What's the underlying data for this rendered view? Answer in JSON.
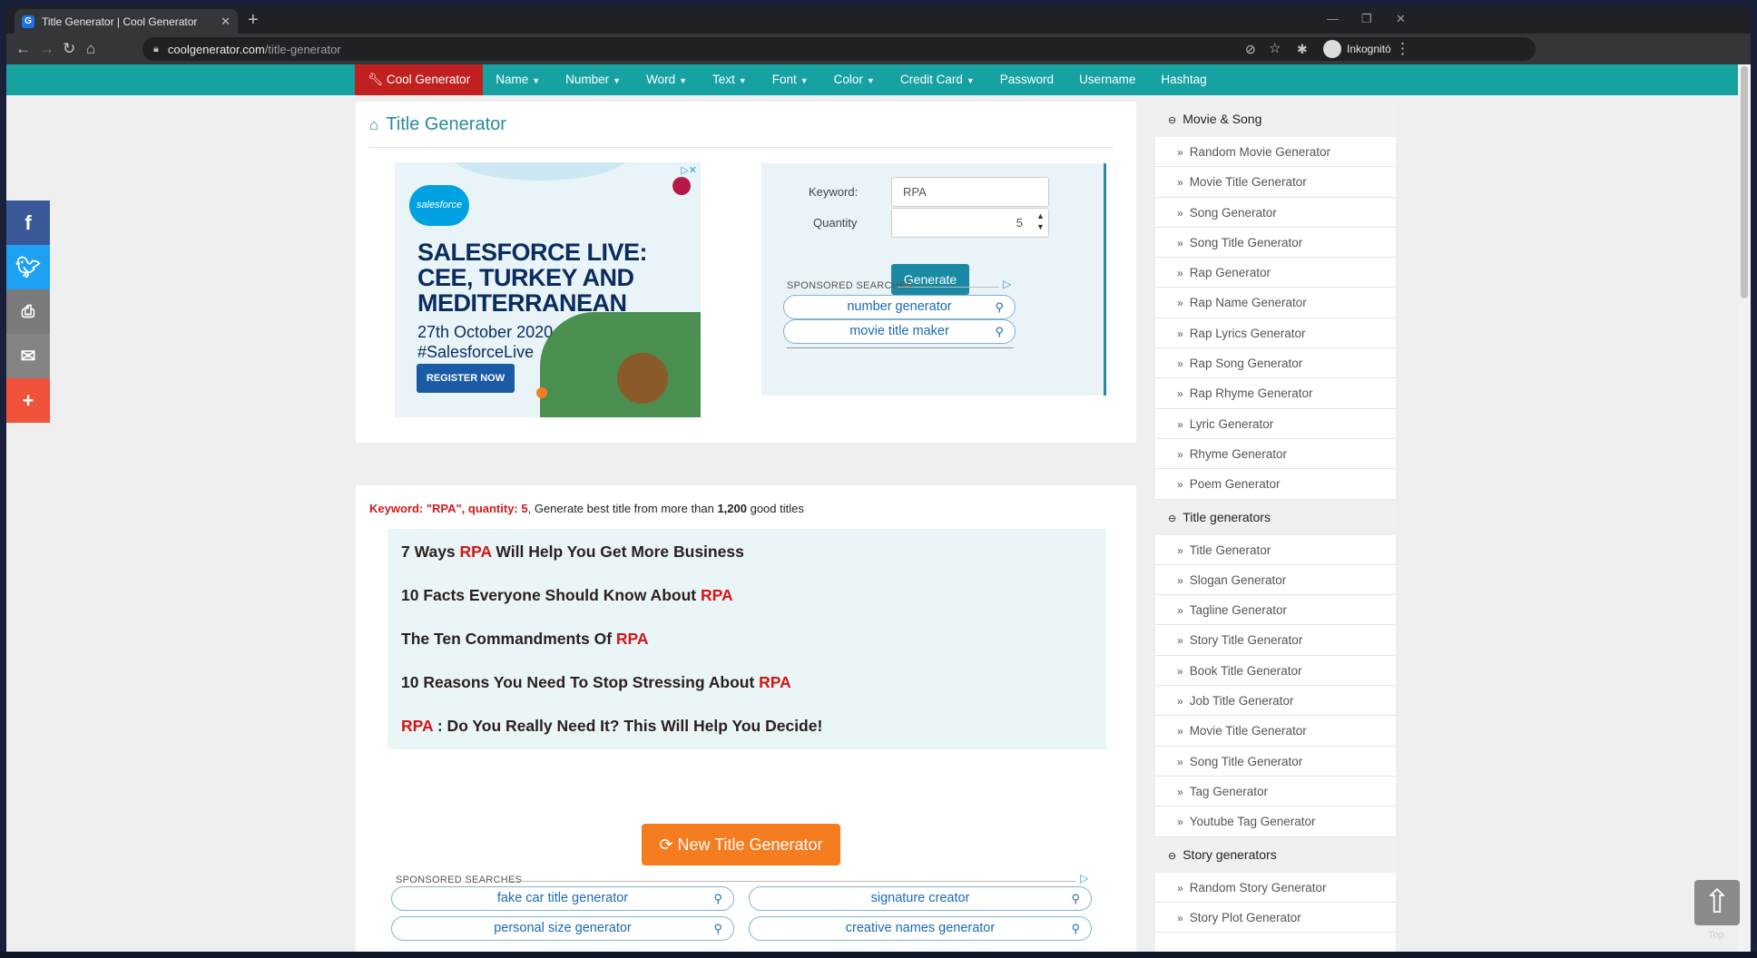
{
  "browser": {
    "tab_title": "Title Generator | Cool Generator",
    "tab_favicon": "G",
    "url_host": "coolgenerator.com",
    "url_path": "/title-generator",
    "incognito_label": "Inkognitó"
  },
  "menu": {
    "brand": "Cool Generator",
    "items": [
      {
        "label": "Name",
        "dropdown": true
      },
      {
        "label": "Number",
        "dropdown": true
      },
      {
        "label": "Word",
        "dropdown": true
      },
      {
        "label": "Text",
        "dropdown": true
      },
      {
        "label": "Font",
        "dropdown": true
      },
      {
        "label": "Color",
        "dropdown": true
      },
      {
        "label": "Credit Card",
        "dropdown": true
      },
      {
        "label": "Password",
        "dropdown": false
      },
      {
        "label": "Username",
        "dropdown": false
      },
      {
        "label": "Hashtag",
        "dropdown": false
      }
    ]
  },
  "page": {
    "title": "Title Generator"
  },
  "ad": {
    "logo": "salesforce",
    "headline_1": "SALESFORCE LIVE:",
    "headline_2": "CEE, TURKEY AND",
    "headline_3": "MEDITERRANEAN",
    "date": "27th October 2020",
    "hashtag": "#SalesforceLive",
    "cta": "REGISTER NOW"
  },
  "form": {
    "keyword_label": "Keyword:",
    "keyword_value": "RPA",
    "quantity_label": "Quantity",
    "quantity_value": "5",
    "generate_label": "Generate",
    "sponsored_label": "SPONSORED SEARCHES",
    "sponsored": [
      "number generator",
      "movie title maker"
    ]
  },
  "results": {
    "summary_kw": "Keyword: \"RPA\", quantity: 5",
    "summary_mid": ", Generate best title from more than ",
    "summary_count": "1,200",
    "summary_end": " good titles",
    "keyword": "RPA",
    "titles": [
      {
        "pre": "7 Ways ",
        "kw": "RPA",
        "post": " Will Help You Get More Business"
      },
      {
        "pre": "10 Facts Everyone Should Know About ",
        "kw": "RPA",
        "post": ""
      },
      {
        "pre": "The Ten Commandments Of ",
        "kw": "RPA",
        "post": ""
      },
      {
        "pre": "10 Reasons You Need To Stop Stressing About ",
        "kw": "RPA",
        "post": ""
      },
      {
        "pre": "",
        "kw": "RPA",
        "post": " : Do You Really Need It? This Will Help You Decide!"
      }
    ],
    "new_button": "New Title Generator",
    "sponsored_label": "SPONSORED SEARCHES",
    "sponsored": [
      "fake car title generator",
      "signature creator",
      "personal size generator",
      "creative names generator"
    ]
  },
  "sidebar": {
    "sections": [
      {
        "title": "Movie & Song",
        "items": [
          "Random Movie Generator",
          "Movie Title Generator",
          "Song Generator",
          "Song Title Generator",
          "Rap Generator",
          "Rap Name Generator",
          "Rap Lyrics Generator",
          "Rap Song Generator",
          "Rap Rhyme Generator",
          "Lyric Generator",
          "Rhyme Generator",
          "Poem Generator"
        ]
      },
      {
        "title": "Title generators",
        "items": [
          "Title Generator",
          "Slogan Generator",
          "Tagline Generator",
          "Story Title Generator",
          "Book Title Generator",
          "Job Title Generator",
          "Movie Title Generator",
          "Song Title Generator",
          "Tag Generator",
          "Youtube Tag Generator"
        ]
      },
      {
        "title": "Story generators",
        "items": [
          "Random Story Generator",
          "Story Plot Generator"
        ]
      }
    ]
  },
  "to_top": "Top",
  "colors": {
    "menu_bg": "#17a2a2",
    "brand_bg": "#c0201f",
    "keyword_red": "#d41515",
    "new_button": "#f57c1f",
    "facebook": "#3b5998",
    "twitter": "#1da1f2",
    "print": "#7a7a7a",
    "email": "#848484",
    "share": "#f0533a"
  }
}
